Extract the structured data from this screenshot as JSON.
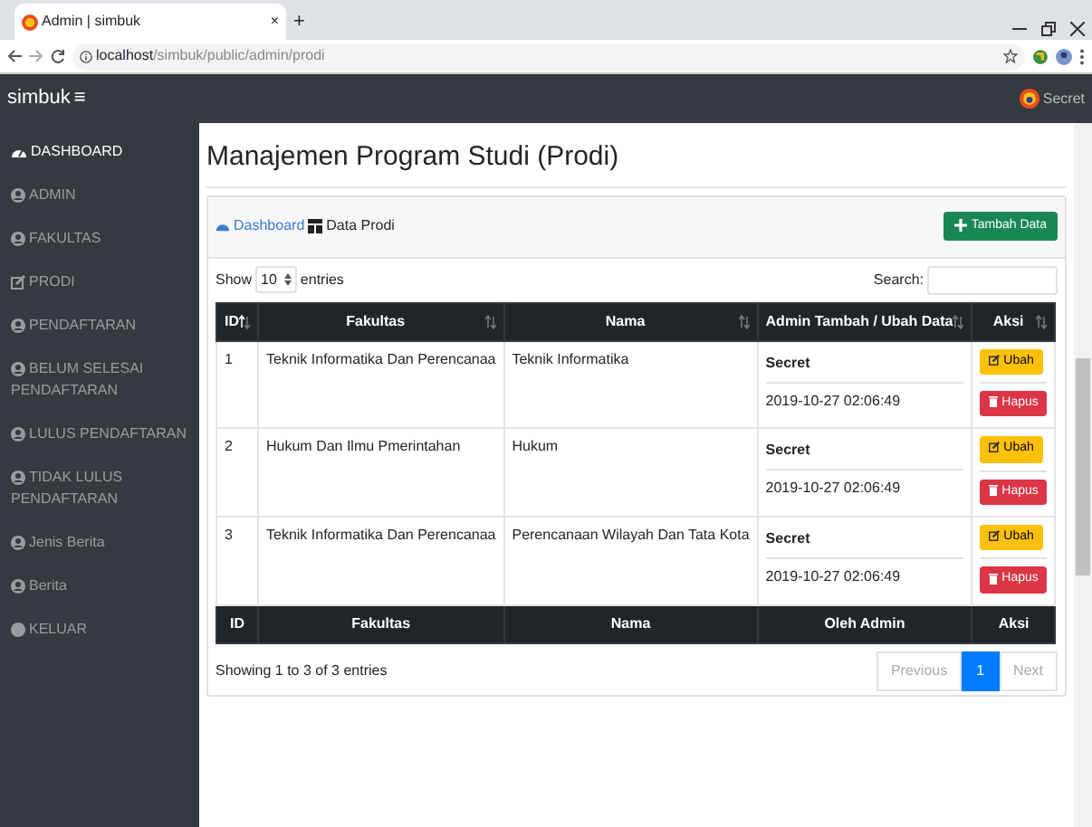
{
  "browser": {
    "tab_title": "Admin | simbuk",
    "tab_close": "×",
    "new_tab": "+",
    "url_host": "localhost",
    "url_path": "/simbuk/public/admin/prodi"
  },
  "navbar": {
    "brand": "simbuk",
    "menu_glyph": "≡",
    "user": "Secret"
  },
  "sidebar": {
    "items": [
      {
        "label": "DASHBOARD",
        "kind": "gauge",
        "selected": true
      },
      {
        "label": "ADMIN",
        "kind": "user",
        "selected": false
      },
      {
        "label": "FAKULTAS",
        "kind": "user",
        "selected": false
      },
      {
        "label": "PRODI",
        "kind": "edit",
        "selected": false
      },
      {
        "label": "PENDAFTARAN",
        "kind": "user",
        "selected": false
      },
      {
        "label": "BELUM SELESAI PENDAFTARAN",
        "kind": "user",
        "selected": false
      },
      {
        "label": "LULUS PENDAFTARAN",
        "kind": "user",
        "selected": false
      },
      {
        "label": "TIDAK LULUS PENDAFTARAN",
        "kind": "user",
        "selected": false
      },
      {
        "label": "Jenis Berita",
        "kind": "user",
        "selected": false
      },
      {
        "label": "Berita",
        "kind": "user",
        "selected": false
      },
      {
        "label": "KELUAR",
        "kind": "dot",
        "selected": false
      }
    ]
  },
  "page_title": "Manajemen Program Studi (Prodi)",
  "breadcrumb": [
    {
      "label": "Dashboard",
      "kind": "link"
    },
    {
      "label": "Data Prodi",
      "kind": "current"
    }
  ],
  "add_button": "Tambah Data",
  "length": {
    "show_label": "Show",
    "value": "10",
    "entries_label": "entries"
  },
  "search": {
    "label": "Search:"
  },
  "table": {
    "columns": [
      {
        "label": "ID",
        "sorted": true
      },
      {
        "label": "Fakultas",
        "sorted": false
      },
      {
        "label": "Nama",
        "sorted": false
      },
      {
        "label": "Admin Tambah / Ubah Data",
        "sorted": false
      },
      {
        "label": "Aksi",
        "sorted": false
      }
    ],
    "rows": [
      {
        "id": "1",
        "fakultas": "Teknik Informatika Dan Perencanaa",
        "nama": "Teknik Informatika",
        "admin": "Secret",
        "date": "2019-10-27 02:06:49",
        "edit": "Ubah",
        "delete": "Hapus"
      },
      {
        "id": "2",
        "fakultas": "Hukum Dan Ilmu Pmerintahan",
        "nama": "Hukum",
        "admin": "Secret",
        "date": "2019-10-27 02:06:49",
        "edit": "Ubah",
        "delete": "Hapus"
      },
      {
        "id": "3",
        "fakultas": "Teknik Informatika Dan Perencanaa",
        "nama": "Perencanaan Wilayah Dan Tata Kota",
        "admin": "Secret",
        "date": "2019-10-27 02:06:49",
        "edit": "Ubah",
        "delete": "Hapus"
      }
    ],
    "footer_columns": [
      "ID",
      "Fakultas",
      "Nama",
      "Oleh Admin",
      "Aksi"
    ]
  },
  "info": "Showing 1 to 3 of 3 entries",
  "pagination": {
    "previous": {
      "label": "Previous",
      "disabled": true
    },
    "pages": [
      {
        "label": "1",
        "selected": true
      }
    ],
    "next": {
      "label": "Next",
      "disabled": true
    }
  }
}
